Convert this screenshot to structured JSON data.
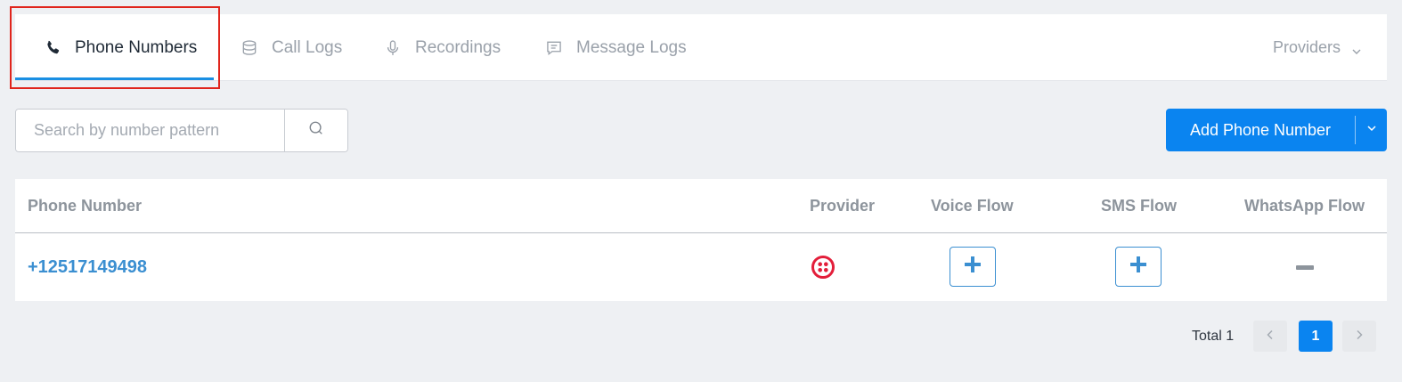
{
  "tabs": [
    {
      "label": "Phone Numbers",
      "icon": "phone-icon",
      "active": true
    },
    {
      "label": "Call Logs",
      "icon": "database-icon",
      "active": false
    },
    {
      "label": "Recordings",
      "icon": "microphone-icon",
      "active": false
    },
    {
      "label": "Message Logs",
      "icon": "message-icon",
      "active": false
    }
  ],
  "providers": {
    "label": "Providers",
    "icon": "chevron-down-icon"
  },
  "search": {
    "placeholder": "Search by number pattern",
    "value": "",
    "icon": "search-icon"
  },
  "add_button": {
    "label": "Add Phone Number",
    "toggle_icon": "chevron-down-icon"
  },
  "table": {
    "columns": [
      "Phone Number",
      "Provider",
      "Voice Flow",
      "SMS Flow",
      "WhatsApp Flow"
    ],
    "rows": [
      {
        "phone_number": "+12517149498",
        "provider_icon": "twilio-logo-icon",
        "voice_flow": "plus-icon",
        "sms_flow": "plus-icon",
        "whatsapp_flow": "minus-icon"
      }
    ]
  },
  "pagination": {
    "total_label": "Total 1",
    "current_page": "1"
  },
  "colors": {
    "accent": "#0a84f0",
    "link": "#3b8fd1",
    "twilio": "#e31e3a",
    "highlight": "#e0251c"
  }
}
